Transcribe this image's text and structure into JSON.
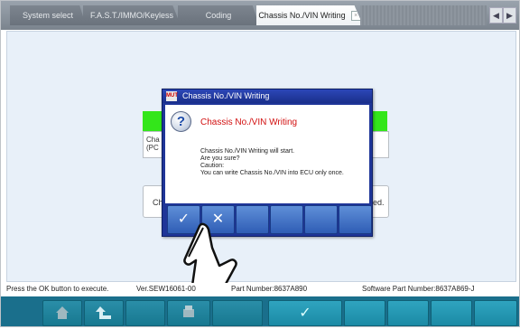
{
  "tabs": [
    {
      "label": "System select"
    },
    {
      "label": "F.A.S.T./IMMO/Keyless"
    },
    {
      "label": "Coding"
    },
    {
      "label": "Chassis No./VIN Writing"
    }
  ],
  "tab_close": "×",
  "tab_nav": {
    "prev": "◀",
    "next": "▶"
  },
  "background": {
    "panel_a_lines": [
      "Cha",
      "(PC"
    ],
    "panel_b_left": "Ch",
    "panel_b_right": "ed."
  },
  "dialog": {
    "title": "Chassis No./VIN Writing",
    "title_icon": "MUT",
    "heading": "Chassis No./VIN Writing",
    "icon": "question-icon",
    "message_lines": [
      "Chassis No./VIN Writing will start.",
      "Are you sure?",
      "Caution:",
      "You can write Chassis No./VIN into ECU only once."
    ],
    "ok_symbol": "✓",
    "cancel_symbol": "✕"
  },
  "status": {
    "hint": "Press the OK button to execute.",
    "version": "Ver.SEW16061-00",
    "part_number": "Part Number:8637A890",
    "software_part_number": "Software Part Number:8637A869-J"
  },
  "bottom_bar": {
    "ok_symbol": "✓",
    "icons": [
      "home-icon",
      "back-arrow-icon",
      "print-icon",
      "ok-check-icon"
    ]
  },
  "colors": {
    "dialog_frame": "#1f3598",
    "heading_red": "#d21010",
    "status_green": "#33e61a",
    "bottom_bar": "#1a6f8c"
  }
}
